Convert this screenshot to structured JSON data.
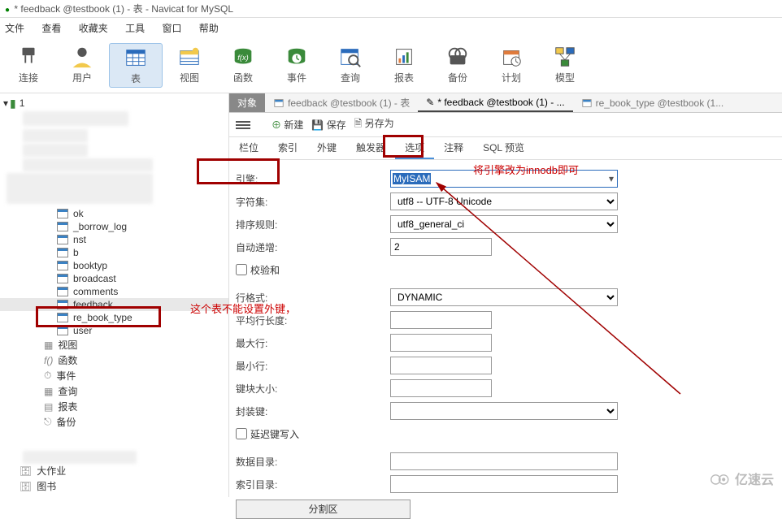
{
  "title": "* feedback @testbook (1) - 表 - Navicat for MySQL",
  "menu": [
    "文件",
    "查看",
    "收藏夹",
    "工具",
    "窗口",
    "帮助"
  ],
  "toolbar": [
    {
      "label": "连接",
      "id": "connect"
    },
    {
      "label": "用户",
      "id": "user"
    },
    {
      "label": "表",
      "id": "table"
    },
    {
      "label": "视图",
      "id": "view"
    },
    {
      "label": "函数",
      "id": "func"
    },
    {
      "label": "事件",
      "id": "event"
    },
    {
      "label": "查询",
      "id": "query"
    },
    {
      "label": "报表",
      "id": "report"
    },
    {
      "label": "备份",
      "id": "backup"
    },
    {
      "label": "计划",
      "id": "schedule"
    },
    {
      "label": "模型",
      "id": "model"
    }
  ],
  "tree": {
    "root": "1",
    "tables": [
      "ok",
      "_borrow_log",
      "nst",
      "b",
      "booktyp",
      "broadcast",
      "comments",
      "feedback",
      "re_book_type",
      "user"
    ],
    "sections": [
      {
        "label": "视图",
        "icon": "view"
      },
      {
        "label": "函数",
        "icon": "func"
      },
      {
        "label": "事件",
        "icon": "event"
      },
      {
        "label": "查询",
        "icon": "query"
      },
      {
        "label": "报表",
        "icon": "report"
      },
      {
        "label": "备份",
        "icon": "backup"
      }
    ],
    "bottom": [
      "大作业",
      "图书"
    ]
  },
  "content_tabs": {
    "obj": "对象",
    "t1": "feedback @testbook (1) - 表",
    "t2": "* feedback @testbook (1) - ...",
    "t3": "re_book_type @testbook (1..."
  },
  "subtoolbar": {
    "new": "新建",
    "save": "保存",
    "saveas": "另存为"
  },
  "designer_tabs": [
    "栏位",
    "索引",
    "外键",
    "触发器",
    "选项",
    "注释",
    "SQL 预览"
  ],
  "form": {
    "engine_label": "引擎:",
    "engine_value": "MyISAM",
    "charset_label": "字符集:",
    "charset_value": "utf8 -- UTF-8 Unicode",
    "collation_label": "排序规则:",
    "collation_value": "utf8_general_ci",
    "autoinc_label": "自动递增:",
    "autoinc_value": "2",
    "checksum_label": "校验和",
    "rowformat_label": "行格式:",
    "rowformat_value": "DYNAMIC",
    "avgrowlen_label": "平均行长度:",
    "maxrows_label": "最大行:",
    "minrows_label": "最小行:",
    "keyblock_label": "键块大小:",
    "packkeys_label": "封装键:",
    "delaywrite_label": "延迟键写入",
    "datadir_label": "数据目录:",
    "indexdir_label": "索引目录:",
    "partition_btn": "分割区"
  },
  "annotations": {
    "cannot_fk": "这个表不能设置外键，",
    "change_engine": "将引擎改为innodb即可"
  },
  "watermark": "亿速云"
}
